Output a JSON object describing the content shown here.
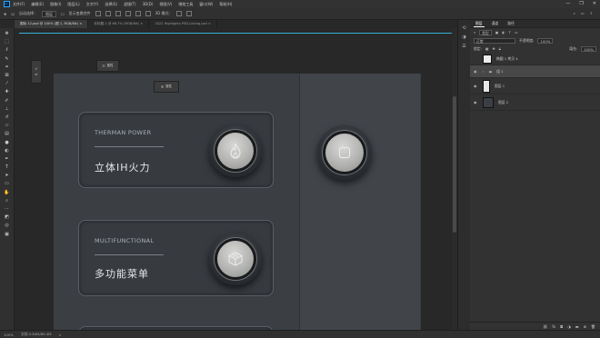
{
  "menubar": {
    "app_logo": "Ps",
    "items": [
      "文件(F)",
      "编辑(E)",
      "图像(I)",
      "图层(L)",
      "文字(Y)",
      "选择(S)",
      "滤镜(T)",
      "3D(D)",
      "视图(V)",
      "增效工具",
      "窗口(W)",
      "帮助(H)"
    ],
    "window_controls": [
      "—",
      "❐",
      "✕"
    ]
  },
  "options": {
    "auto_select": "自动选择：",
    "target": "图层",
    "transform": "显示变换控件",
    "mode3d": "3D 模式："
  },
  "tabs": [
    {
      "label": "图标 12.psd @ 100% (图 1, RGB/8#) ×",
      "active": true
    },
    {
      "label": "未标题-1 @ 66.7% (RGB/8#) ×",
      "active": false
    },
    {
      "label": "2022 Highlights PSD-Listing.psd ×",
      "active": false
    }
  ],
  "floating": {
    "panel1_label": "属性",
    "panel2_label": "属性"
  },
  "cards": [
    {
      "kicker": "THERMAN POWER",
      "title": "立体IH火力",
      "icon": "flame-icon"
    },
    {
      "kicker": "MULTIFUNCTIONAL",
      "title": "多功能菜单",
      "icon": "cube-icon"
    }
  ],
  "side_knob_icon": "square-icon",
  "statusbar": {
    "zoom": "100%",
    "info": "文档:3.84M/69.4M",
    "arrow": ">"
  },
  "layers_panel": {
    "tabs": [
      "图层",
      "通道",
      "路径"
    ],
    "filter_label": "类型",
    "blend_mode": "正常",
    "opacity_label": "不透明度:",
    "opacity_value": "100%",
    "lock_label": "锁定:",
    "fill_label": "填充:",
    "fill_value": "100%",
    "layers": [
      {
        "name": "椭圆 1 拷贝 4",
        "thumb": "check",
        "selected": false
      },
      {
        "name": "组 1",
        "thumb": "folder",
        "selected": true
      },
      {
        "name": "图层 1",
        "thumb": "light",
        "selected": false
      },
      {
        "name": "图层 2",
        "thumb": "dark",
        "selected": false
      }
    ],
    "bottom_icons": [
      "link-icon",
      "fx-icon",
      "mask-icon",
      "adjust-icon",
      "folder-icon",
      "new-layer-icon",
      "trash-icon"
    ]
  },
  "colors": {
    "accent": "#31a8ff",
    "guide": "#34b3d8"
  }
}
